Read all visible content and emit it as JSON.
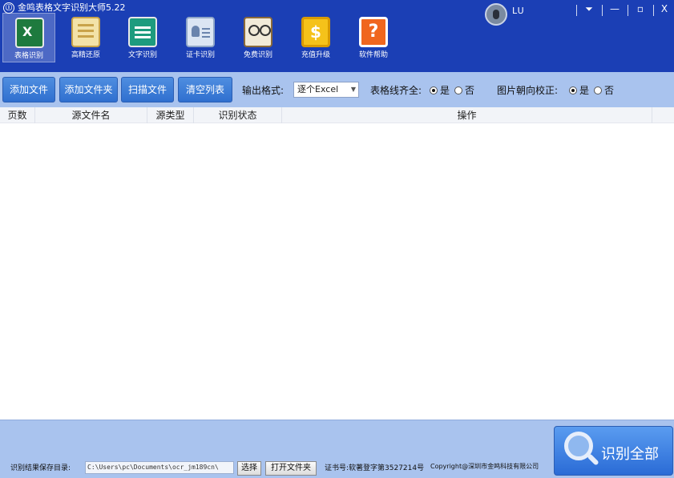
{
  "window": {
    "title": "金鸣表格文字识别大师5.22",
    "logo_glyph": "Ⓘ",
    "user": "LU",
    "controls": {
      "menu": "⏷",
      "minimize": "—",
      "maximize": "▫",
      "close": "X"
    }
  },
  "toolbar": {
    "items": [
      {
        "label": "表格识别",
        "icon": "excel-icon",
        "active": true
      },
      {
        "label": "高精还原",
        "icon": "document-icon",
        "active": false
      },
      {
        "label": "文字识别",
        "icon": "text-doc-icon",
        "active": false
      },
      {
        "label": "证卡识别",
        "icon": "id-card-icon",
        "active": false
      },
      {
        "label": "免费识别",
        "icon": "book-glasses-icon",
        "active": false
      },
      {
        "label": "充值升级",
        "icon": "coin-icon",
        "active": false
      },
      {
        "label": "软件帮助",
        "icon": "help-icon",
        "active": false
      }
    ]
  },
  "actions": {
    "add_file": "添加文件",
    "add_folder": "添加文件夹",
    "scan_file": "扫描文件",
    "clear_list": "清空列表",
    "output_format_label": "输出格式:",
    "output_format_value": "逐个Excel",
    "gridline_label": "表格线齐全:",
    "gridline_yes": "是",
    "gridline_no": "否",
    "gridline_selected": "yes",
    "orientation_label": "图片朝向校正:",
    "orientation_yes": "是",
    "orientation_no": "否",
    "orientation_selected": "yes"
  },
  "table": {
    "columns": [
      "页数",
      "源文件名",
      "源类型",
      "识别状态",
      "操作"
    ],
    "rows": []
  },
  "footer": {
    "save_dir_label": "识别结果保存目录:",
    "save_dir_value": "C:\\Users\\pc\\Documents\\ocr_jm189cn\\",
    "choose_button": "选择",
    "open_folder_button": "打开文件夹",
    "certificate": "证书号:软著登字第3527214号",
    "copyright": "Copyright@深圳市金鸣科技有限公司",
    "recognize_all": "识别全部"
  },
  "colors": {
    "header": "#1b3fb5",
    "panel": "#a9c3ee",
    "button": "#2f6fcf"
  }
}
